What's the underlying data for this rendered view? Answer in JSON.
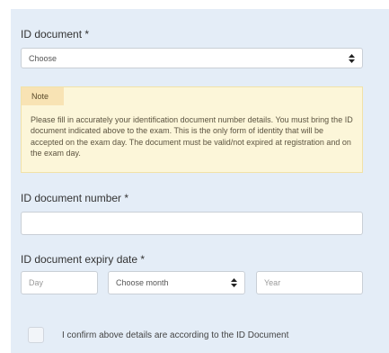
{
  "id_document": {
    "label": "ID document *",
    "selected": "Choose"
  },
  "note": {
    "title": "Note",
    "text": "Please fill in accurately your identification document number details. You must bring the ID document indicated above to the exam. This is the only form of identity that will be accepted on the exam day. The document must be valid/not expired at registration and on the exam day."
  },
  "id_number": {
    "label": "ID document number *",
    "value": ""
  },
  "expiry": {
    "label": "ID document expiry date *",
    "day_placeholder": "Day",
    "month_selected": "Choose month",
    "year_placeholder": "Year"
  },
  "confirm": {
    "checked": false,
    "label": "I confirm above details are according to the ID Document"
  },
  "icons": {
    "select_arrows": "up-down-arrows-icon"
  }
}
